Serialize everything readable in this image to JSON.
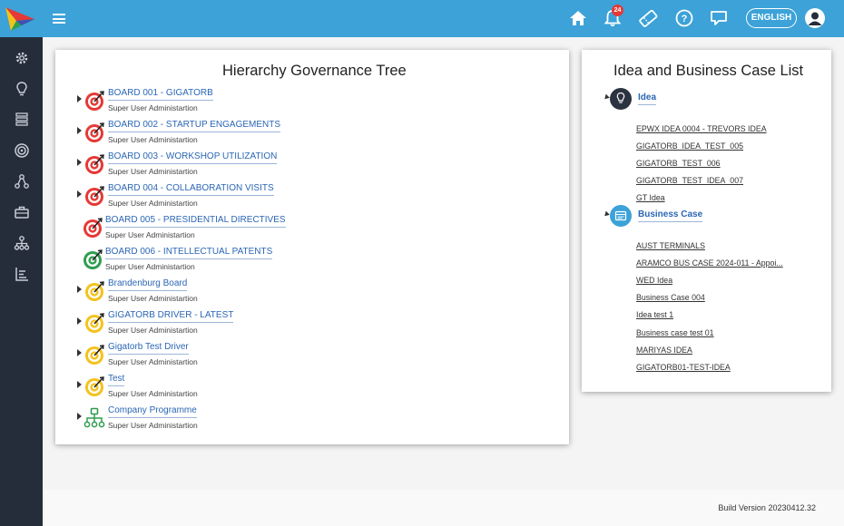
{
  "header": {
    "language_label": "ENGLISH",
    "notification_count": "24",
    "icons": [
      "home-icon",
      "bell-icon",
      "ticket-icon",
      "help-icon",
      "chat-icon",
      "user-icon"
    ]
  },
  "sidebar": {
    "items": [
      "settings-icon",
      "idea-icon",
      "stack-icon",
      "target-icon",
      "network-icon",
      "briefcase-icon",
      "hierarchy-icon",
      "chart-icon"
    ]
  },
  "governance": {
    "title": "Hierarchy Governance Tree",
    "nodes": [
      {
        "name": "BOARD 001 - GIGATORB",
        "subtitle": "Super User Administartion",
        "icon": "target-red-icon",
        "color": "#e53935"
      },
      {
        "name": "BOARD 002 - STARTUP ENGAGEMENTS",
        "subtitle": "Super User Administartion",
        "icon": "target-red-icon",
        "color": "#e53935"
      },
      {
        "name": "BOARD 003 - WORKSHOP UTILIZATION",
        "subtitle": "Super User Administartion",
        "icon": "target-red-icon",
        "color": "#e53935"
      },
      {
        "name": "BOARD 004 - COLLABORATION VISITS",
        "subtitle": "Super User Administartion",
        "icon": "target-red-icon",
        "color": "#e53935"
      },
      {
        "name": "BOARD 005 - PRESIDENTIAL DIRECTIVES",
        "subtitle": "Super User Administartion",
        "icon": "target-red-icon",
        "color": "#e53935"
      },
      {
        "name": "BOARD 006 - INTELLECTUAL PATENTS",
        "subtitle": "Super User Administartion",
        "icon": "target-green-icon",
        "color": "#2e9e4f"
      },
      {
        "name": "Brandenburg Board",
        "subtitle": "Super User Administartion",
        "icon": "target-yellow-icon",
        "color": "#f4c21b"
      },
      {
        "name": "GIGATORB DRIVER - LATEST",
        "subtitle": "Super User Administartion",
        "icon": "target-yellow-icon",
        "color": "#f4c21b"
      },
      {
        "name": "Gigatorb Test Driver",
        "subtitle": "Super User Administartion",
        "icon": "target-yellow-icon",
        "color": "#f4c21b"
      },
      {
        "name": "Test",
        "subtitle": "Super User Administartion",
        "icon": "target-yellow-icon",
        "color": "#f4c21b"
      },
      {
        "name": "Company Programme",
        "subtitle": "Super User Administartion",
        "icon": "org-chart-icon",
        "color": "#2e9e4f"
      }
    ]
  },
  "idea_list": {
    "title": "Idea and Business Case List",
    "groups": [
      {
        "label": "Idea",
        "icon": "lightbulb-icon",
        "items": [
          "EPWX IDEA 0004 - TREVORS IDEA",
          "GIGATORB_IDEA_TEST_005",
          "GIGATORB_TEST_006",
          "GIGATORB_TEST_IDEA_007",
          "GT Idea"
        ]
      },
      {
        "label": "Business Case",
        "icon": "business-case-icon",
        "items": [
          "AUST TERMINALS",
          "ARAMCO BUS CASE 2024-011 - Appoi...",
          "WED Idea",
          "Business Case 004",
          "Idea test 1",
          "Business case test 01",
          "MARIYAS IDEA",
          "GIGATORB01-TEST-IDEA"
        ]
      }
    ]
  },
  "footer": {
    "build": "Build Version 20230412.32"
  },
  "colors": {
    "topbar": "#3ca2d8",
    "sidebar": "#252c3a",
    "link": "#2a66b5"
  }
}
